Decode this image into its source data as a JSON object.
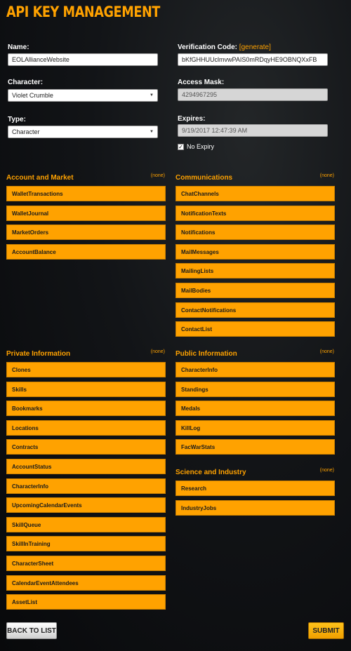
{
  "header": {
    "title": "API KEY MANAGEMENT"
  },
  "form": {
    "name_label": "Name:",
    "name_value": "EOLAllianceWebsite",
    "verification_label": "Verification Code:",
    "verification_generate_open": "[",
    "verification_generate": "generate",
    "verification_generate_close": "]",
    "verification_value": "bKfGHHUUclmvwPAIS0mRDqyHE9OBNQXxFB",
    "character_label": "Character:",
    "character_value": "Violet Crumble",
    "access_mask_label": "Access Mask:",
    "access_mask_value": "4294967295",
    "type_label": "Type:",
    "type_value": "Character",
    "expires_label": "Expires:",
    "expires_value": "9/19/2017 12:47:39 AM",
    "no_expiry_label": "No Expiry",
    "no_expiry_checked": true
  },
  "sections": {
    "account": {
      "title": "Account and Market",
      "none": "(none)",
      "items": [
        "WalletTransactions",
        "WalletJournal",
        "MarketOrders",
        "AccountBalance"
      ]
    },
    "communications": {
      "title": "Communications",
      "none": "(none)",
      "items": [
        "ChatChannels",
        "NotificationTexts",
        "Notifications",
        "MailMessages",
        "MailingLists",
        "MailBodies",
        "ContactNotifications",
        "ContactList"
      ]
    },
    "private": {
      "title": "Private Information",
      "none": "(none)",
      "items": [
        "Clones",
        "Skills",
        "Bookmarks",
        "Locations",
        "Contracts",
        "AccountStatus",
        "CharacterInfo",
        "UpcomingCalendarEvents",
        "SkillQueue",
        "SkillInTraining",
        "CharacterSheet",
        "CalendarEventAttendees",
        "AssetList"
      ]
    },
    "public": {
      "title": "Public Information",
      "none": "(none)",
      "items": [
        "CharacterInfo",
        "Standings",
        "Medals",
        "KillLog",
        "FacWarStats"
      ]
    },
    "science": {
      "title": "Science and Industry",
      "none": "(none)",
      "items": [
        "Research",
        "IndustryJobs"
      ]
    }
  },
  "buttons": {
    "back": "BACK TO LIST",
    "submit": "SUBMIT"
  },
  "colors": {
    "accent": "#ffa200",
    "background": "#0d0f12"
  }
}
